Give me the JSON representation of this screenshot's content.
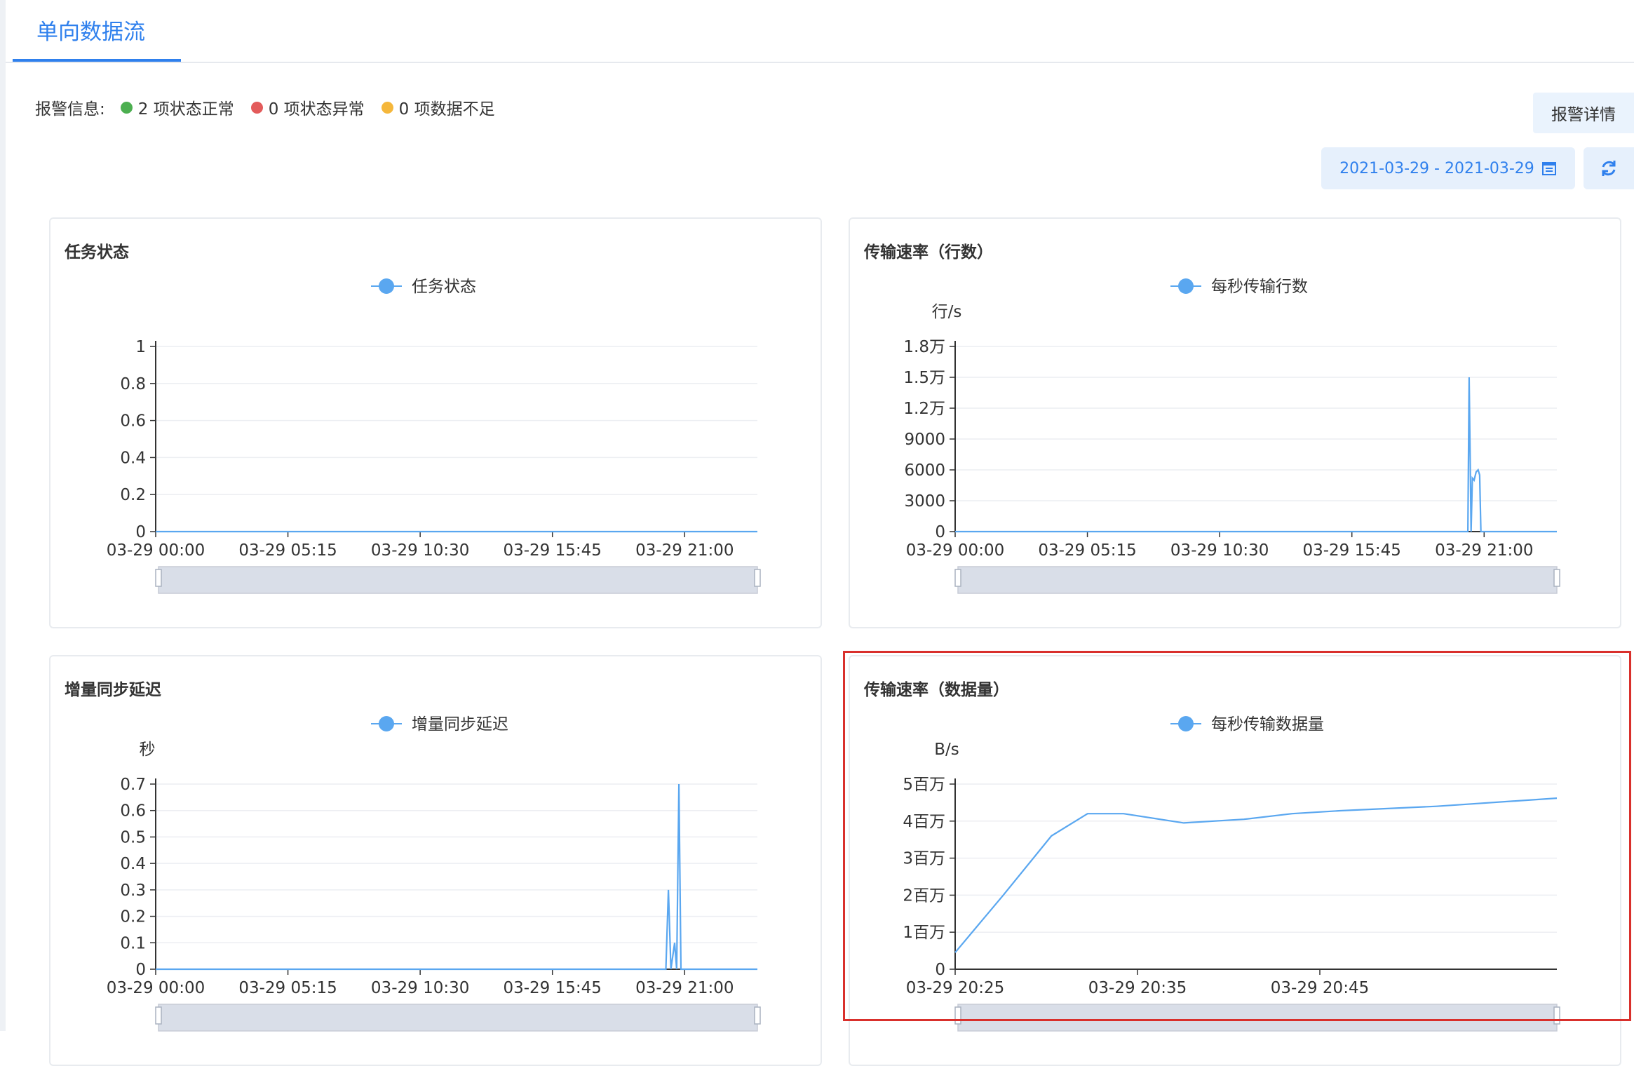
{
  "tabs": [
    {
      "label": "单向数据流"
    }
  ],
  "alarm": {
    "label": "报警信息:",
    "items": [
      {
        "text": "2 项状态正常",
        "color": "#4caf50"
      },
      {
        "text": "0 项状态异常",
        "color": "#e35b5b"
      },
      {
        "text": "0 项数据不足",
        "color": "#f5b73b"
      }
    ]
  },
  "toolbar": {
    "detail_label": "报警详情",
    "date_range": "2021-03-29 - 2021-03-29",
    "calendar_icon": "calendar-icon",
    "refresh_icon": "refresh-icon"
  },
  "colors": {
    "accent": "#2f80ed",
    "series": "#5aa7f0"
  },
  "chart_data": [
    {
      "title": "任务状态",
      "type": "line",
      "legend": "任务状态",
      "ylabel": "",
      "ylim": [
        0,
        1
      ],
      "yticks": [
        "1",
        "0.8",
        "0.6",
        "0.4",
        "0.2",
        "0"
      ],
      "xticks": [
        "03-29 00:00",
        "03-29 05:15",
        "03-29 10:30",
        "03-29 15:45",
        "03-29 21:00"
      ],
      "x": [
        0,
        24
      ],
      "y": [
        0,
        0
      ]
    },
    {
      "title": "传输速率（行数）",
      "type": "line",
      "legend": "每秒传输行数",
      "ylabel": "行/s",
      "ylim": [
        0,
        18000
      ],
      "yticks": [
        "1.8万",
        "1.5万",
        "1.2万",
        "9000",
        "6000",
        "3000",
        "0"
      ],
      "xticks": [
        "03-29 00:00",
        "03-29 05:15",
        "03-29 10:30",
        "03-29 15:45",
        "03-29 21:00"
      ],
      "x": [
        0,
        20.45,
        20.5,
        20.58,
        20.63,
        20.7,
        20.78,
        20.86,
        20.92,
        20.97,
        24
      ],
      "y": [
        0,
        0,
        15000,
        0,
        5200,
        5000,
        5800,
        6000,
        5500,
        0,
        0
      ]
    },
    {
      "title": "增量同步延迟",
      "type": "line",
      "legend": "增量同步延迟",
      "ylabel": "秒",
      "ylim": [
        0,
        0.7
      ],
      "yticks": [
        "0.7",
        "0.6",
        "0.5",
        "0.4",
        "0.3",
        "0.2",
        "0.1",
        "0"
      ],
      "xticks": [
        "03-29 00:00",
        "03-29 05:15",
        "03-29 10:30",
        "03-29 15:45",
        "03-29 21:00"
      ],
      "x": [
        0,
        20.35,
        20.45,
        20.55,
        20.7,
        20.78,
        20.87,
        20.95,
        21.05,
        24
      ],
      "y": [
        0,
        0,
        0.3,
        0,
        0.1,
        0,
        0.7,
        0,
        0,
        0
      ]
    },
    {
      "title": "传输速率（数据量）",
      "type": "line",
      "legend": "每秒传输数据量",
      "ylabel": "B/s",
      "ylim": [
        0,
        5000000
      ],
      "yticks": [
        "5百万",
        "4百万",
        "3百万",
        "2百万",
        "1百万",
        "0"
      ],
      "xticks": [
        "03-29 20:25",
        "03-29 20:35",
        "03-29 20:45"
      ],
      "x": [
        0,
        2,
        4,
        5.5,
        7,
        9.5,
        12,
        14,
        16,
        20,
        25
      ],
      "y": [
        450000,
        2000000,
        3600000,
        4200000,
        4200000,
        3950000,
        4050000,
        4200000,
        4280000,
        4400000,
        4620000
      ]
    }
  ]
}
